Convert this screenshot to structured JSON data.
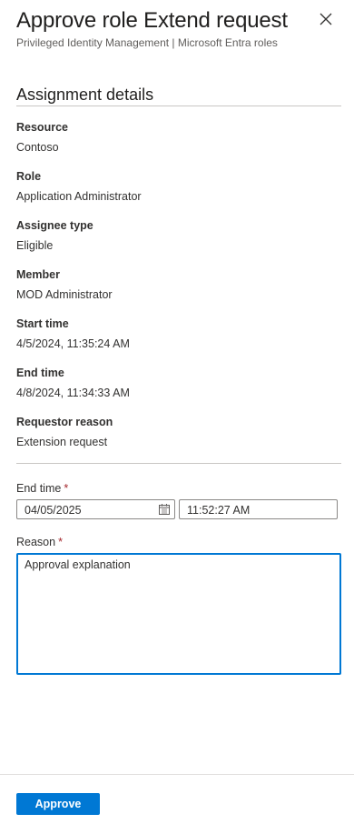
{
  "header": {
    "title": "Approve role Extend request",
    "subtitle": "Privileged Identity Management | Microsoft Entra roles",
    "close_icon": "close-icon"
  },
  "assignment": {
    "section_title": "Assignment details",
    "fields": [
      {
        "label": "Resource",
        "value": "Contoso"
      },
      {
        "label": "Role",
        "value": "Application Administrator"
      },
      {
        "label": "Assignee type",
        "value": "Eligible"
      },
      {
        "label": "Member",
        "value": "MOD Administrator"
      },
      {
        "label": "Start time",
        "value": "4/5/2024, 11:35:24 AM"
      },
      {
        "label": "End time",
        "value": "4/8/2024, 11:34:33 AM"
      },
      {
        "label": "Requestor reason",
        "value": "Extension request"
      }
    ]
  },
  "form": {
    "end_time_label": "End time",
    "required_marker": "*",
    "end_date_value": "04/05/2025",
    "end_time_value": "11:52:27 AM",
    "calendar_icon": "calendar-icon",
    "reason_label": "Reason",
    "reason_value": "Approval explanation"
  },
  "footer": {
    "approve_label": "Approve"
  },
  "colors": {
    "accent": "#0078d4",
    "required": "#a4262c"
  }
}
